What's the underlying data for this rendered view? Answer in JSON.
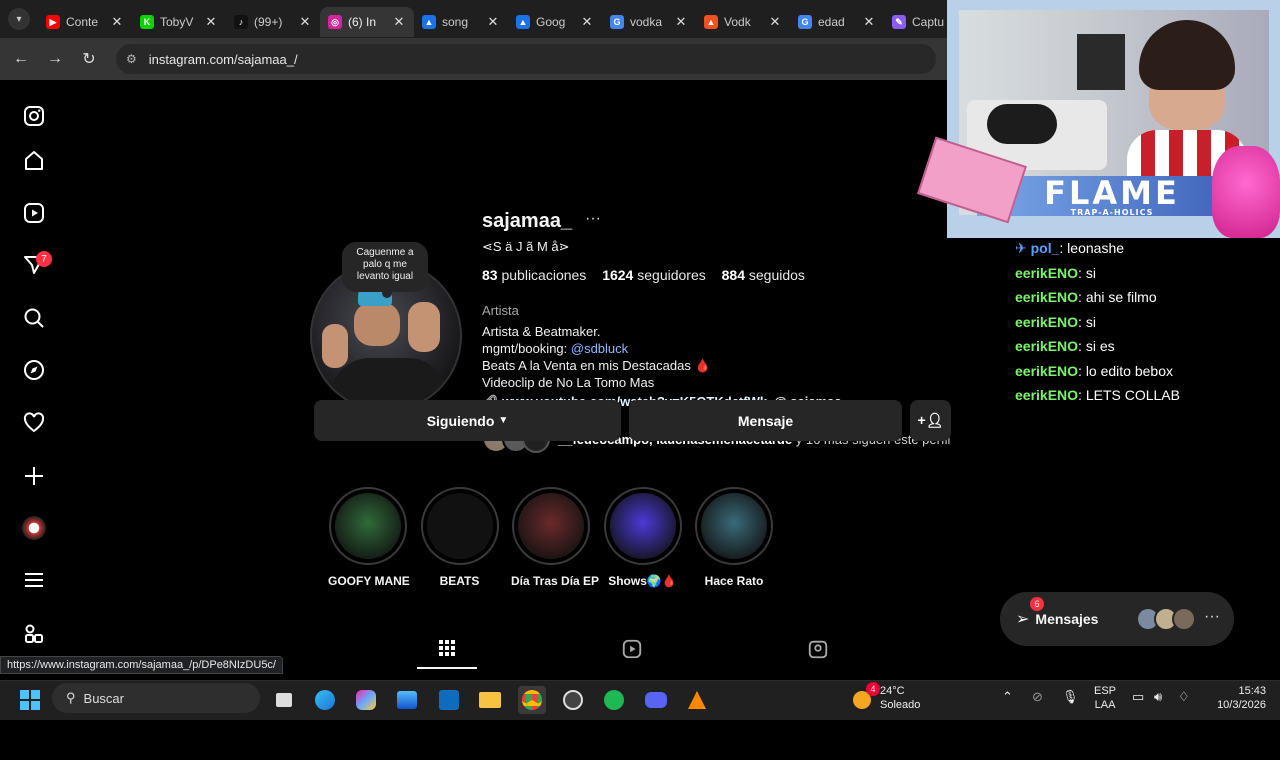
{
  "browser": {
    "tabs": [
      {
        "label": "Conte",
        "color": "#ff0000",
        "glyph": "▶",
        "active": false
      },
      {
        "label": "TobyV",
        "color": "#0ad400",
        "glyph": "K",
        "active": false
      },
      {
        "label": "(99+)",
        "color": "#111111",
        "glyph": "♪",
        "active": false
      },
      {
        "label": "(6) In",
        "color": "#d6249f",
        "glyph": "◎",
        "active": true
      },
      {
        "label": "song",
        "color": "#1a73e8",
        "glyph": "▲",
        "active": false
      },
      {
        "label": "Goog",
        "color": "#1a73e8",
        "glyph": "▲",
        "active": false
      },
      {
        "label": "vodka",
        "color": "#4285f4",
        "glyph": "G",
        "active": false
      },
      {
        "label": "Vodk",
        "color": "#f25022",
        "glyph": "▲",
        "active": false
      },
      {
        "label": "edad",
        "color": "#4285f4",
        "glyph": "G",
        "active": false
      },
      {
        "label": "Captu",
        "color": "#8a5cf6",
        "glyph": "✎",
        "active": false
      }
    ],
    "close_glyph": "✕",
    "url": "instagram.com/sajamaa_/"
  },
  "profile": {
    "username": "sajamaa_",
    "more": "···",
    "full_name": "⋖S ä J ã M å⋗",
    "posts_count": "83",
    "posts_label": "publicaciones",
    "followers_count": "1624",
    "followers_label": "seguidores",
    "following_count": "884",
    "following_label": "seguidos",
    "category": "Artista",
    "bio_line1": "Artista & Beatmaker.",
    "bio_line2_prefix": "mgmt/booking: ",
    "bio_mention": "@sdbluck",
    "bio_line3": "Beats A la Venta en mis Destacadas 🩸",
    "bio_line4": "Videoclip de No La Tomo Mas",
    "link": "www.youtube.com/watch?v=K5QTKdctfWk",
    "threads": "sajamaa_",
    "followed_by_names": "__fedeocampo, lauchasemehacetarde",
    "followed_by_rest": " y 16 más siguen este perfil",
    "note": "Caguenme a palo q me levanto igual"
  },
  "actions": {
    "following": "Siguiendo",
    "message": "Mensaje"
  },
  "highlights": [
    {
      "label": "GOOFY MANE",
      "color": "#2f6b3a"
    },
    {
      "label": "BEATS",
      "color": "#111111"
    },
    {
      "label": "Día Tras Día EP",
      "color": "#6b2a2a"
    },
    {
      "label": "Shows🌍🩸",
      "color": "#4b3ad8"
    },
    {
      "label": "Hace Rato",
      "color": "#3a6b7a"
    }
  ],
  "sidebar": {
    "notif_badge": "7"
  },
  "status_url": "https://www.instagram.com/sajamaa_/p/DPe8NIzDU5c/",
  "overlay": {
    "title": "FLAME",
    "subtitle": "TRAP-A-HOLICS",
    "chat": [
      {
        "user": "pol_",
        "msg": ": leonashe",
        "pinned": true
      },
      {
        "user": "eerikENO",
        "msg": ": si"
      },
      {
        "user": "eerikENO",
        "msg": ": ahi se filmo"
      },
      {
        "user": "eerikENO",
        "msg": ": si"
      },
      {
        "user": "eerikENO",
        "msg": ": si es"
      },
      {
        "user": "eerikENO",
        "msg": ": lo edito bebox"
      },
      {
        "user": "eerikENO",
        "msg": ": LETS COLLAB"
      }
    ]
  },
  "messages_pill": {
    "label": "Mensajes",
    "badge": "6",
    "more": "···"
  },
  "taskbar": {
    "search": "Buscar",
    "weather_temp": "24°C",
    "weather_desc": "Soleado",
    "weather_badge": "4",
    "lang1": "ESP",
    "lang2": "LAA",
    "time": "15:43",
    "date": "10/3/2026"
  }
}
